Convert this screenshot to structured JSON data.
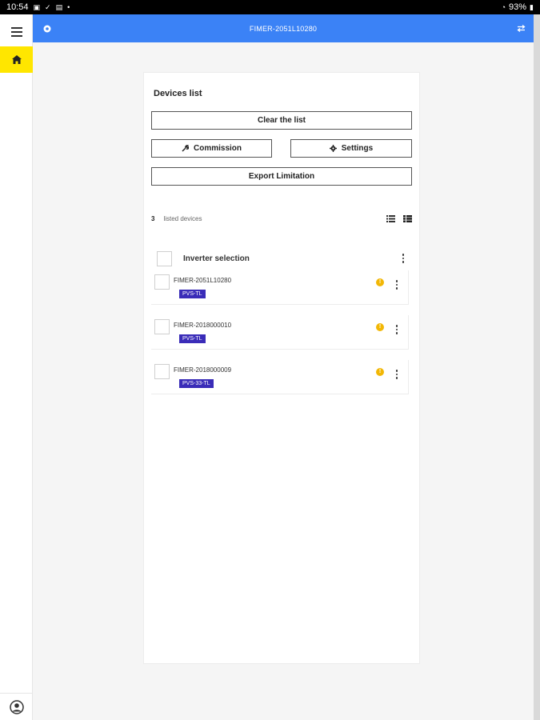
{
  "status_bar": {
    "time": "10:54",
    "battery": "93%"
  },
  "appbar": {
    "title": "FIMER-2051L10280"
  },
  "card": {
    "title": "Devices list",
    "buttons": {
      "clear": "Clear the list",
      "commission": "Commission",
      "settings": "Settings",
      "export": "Export Limitation"
    },
    "count": "3",
    "count_label": "listed devices",
    "selection_label": "Inverter selection",
    "devices": [
      {
        "name": "FIMER-2051L10280",
        "model": "PVS-TL"
      },
      {
        "name": "FIMER-2018000010",
        "model": "PVS-TL"
      },
      {
        "name": "FIMER-2018000009",
        "model": "PVS-33-TL"
      }
    ]
  },
  "colors": {
    "appbar": "#3b82f6",
    "home_active": "#ffe600",
    "badge": "#3a2cb8",
    "warning": "#f2b705"
  },
  "icons": {
    "menu": "hamburger-icon",
    "home": "home-icon",
    "user": "user-account-icon",
    "appbar_left": "circle-dot-icon",
    "appbar_right": "swap-arrows-icon",
    "commission": "wrench-icon",
    "settings": "gear-icon",
    "list_view": "list-view-icon",
    "detail_view": "detail-list-icon",
    "warning": "warning-icon",
    "more": "more-vert-icon"
  }
}
